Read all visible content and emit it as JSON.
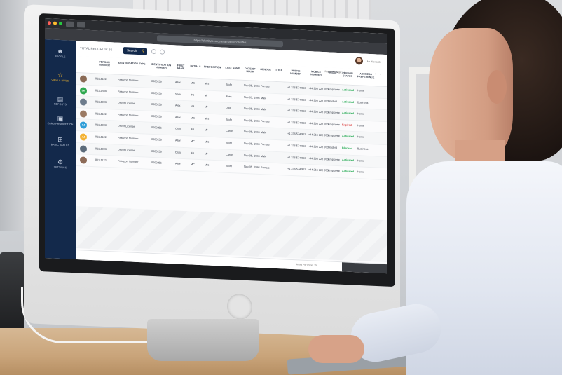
{
  "browser": {
    "url": "https://identityrecords.example/records/list"
  },
  "sidebar": {
    "items": [
      {
        "label": "PEOPLE",
        "icon": "people-icon"
      },
      {
        "label": "VIEW & BUILD",
        "icon": "star-icon"
      },
      {
        "label": "REPORTS",
        "icon": "document-icon"
      },
      {
        "label": "CARD PRODUCTION",
        "icon": "camera-icon"
      },
      {
        "label": "BASIC TABLES",
        "icon": "grid-icon"
      },
      {
        "label": "SETTINGS",
        "icon": "gear-icon"
      }
    ]
  },
  "toolbar": {
    "total_label": "TOTAL RECORDS: 56",
    "search_label": "Search",
    "user_name": "Mr. Kowalski"
  },
  "table": {
    "rows_per_page_label": "Rows Per Page:",
    "columns": [
      "PERSON NUMBER",
      "IDENTIFICATION TYPE",
      "IDENTIFICATION NUMBER",
      "FIRST NAME",
      "INITIALS",
      "PREPOSITION",
      "LAST NAME",
      "DATE OF BIRTH",
      "GENDER",
      "TITLE",
      "PHONE NUMBER",
      "MOBILE NUMBER",
      "GROUP",
      "PERSON STATUS",
      "ADDRESS PREFERENCE"
    ],
    "rows": [
      {
        "avatar": "photo",
        "avatar_color": "#8a6a55",
        "num": "81111122",
        "idtype": "Passport Number",
        "idnum": "0000256",
        "first": "Alton",
        "init": "MC",
        "prep": "Mrs",
        "last": "Jaxfe",
        "dob": "Nov 05, 1986",
        "gender": "Female",
        "title": "",
        "phone": "+1 236 574 963",
        "mobile": "+44 256 222 555",
        "group": "Employee",
        "status": "Activated",
        "status_color": "#1fa84f",
        "addr": "Home"
      },
      {
        "avatar": "SK",
        "avatar_color": "#2ea84f",
        "num": "81111465",
        "idtype": "Passport Number",
        "idnum": "0000256",
        "first": "Sam",
        "init": "TG",
        "prep": "Mr",
        "last": "Allen",
        "dob": "Nov 05, 1986",
        "gender": "Male",
        "title": "",
        "phone": "+1 236 574 963",
        "mobile": "+44 256 222 555",
        "group": "Student",
        "status": "Activated",
        "status_color": "#1fa84f",
        "addr": "Business"
      },
      {
        "avatar": "photo",
        "avatar_color": "#6d7c8c",
        "num": "81111023",
        "idtype": "Driver License",
        "idnum": "0000256",
        "first": "Alex",
        "init": "NB",
        "prep": "Mr",
        "last": "Otto",
        "dob": "Nov 05, 1986",
        "gender": "Male",
        "title": "",
        "phone": "+1 236 574 963",
        "mobile": "+44 256 222 555",
        "group": "Employee",
        "status": "Activated",
        "status_color": "#1fa84f",
        "addr": "Home"
      },
      {
        "avatar": "photo",
        "avatar_color": "#9b7a63",
        "num": "81111122",
        "idtype": "Passport Number",
        "idnum": "0000256",
        "first": "Alton",
        "init": "MC",
        "prep": "Mrs",
        "last": "Jaxfe",
        "dob": "Nov 05, 1986",
        "gender": "Female",
        "title": "",
        "phone": "+1 236 574 963",
        "mobile": "+44 256 222 555",
        "group": "Employee",
        "status": "Expired",
        "status_color": "#d93a3a",
        "addr": "Home"
      },
      {
        "avatar": "CJ",
        "avatar_color": "#2f9ed8",
        "num": "81111020",
        "idtype": "Driver License",
        "idnum": "0000256",
        "first": "Craig",
        "init": "AB",
        "prep": "Mr",
        "last": "Carlos",
        "dob": "Nov 05, 1986",
        "gender": "Male",
        "title": "",
        "phone": "+1 236 574 963",
        "mobile": "+44 256 222 555",
        "group": "Employee",
        "status": "Activated",
        "status_color": "#1fa84f",
        "addr": "Home"
      },
      {
        "avatar": "AJ",
        "avatar_color": "#f3b234",
        "num": "81111122",
        "idtype": "Passport Number",
        "idnum": "0000256",
        "first": "Alton",
        "init": "MC",
        "prep": "Mrs",
        "last": "Jaxfe",
        "dob": "Nov 05, 1986",
        "gender": "Female",
        "title": "",
        "phone": "+1 236 574 963",
        "mobile": "+44 256 222 555",
        "group": "Student",
        "status": "Blocked",
        "status_color": "#1fa84f",
        "addr": "Business"
      },
      {
        "avatar": "photo",
        "avatar_color": "#5c6b7a",
        "num": "81111023",
        "idtype": "Driver License",
        "idnum": "0000256",
        "first": "Craig",
        "init": "AB",
        "prep": "Mr",
        "last": "Carlos",
        "dob": "Nov 05, 1986",
        "gender": "Male",
        "title": "",
        "phone": "+1 236 574 963",
        "mobile": "+44 256 222 555",
        "group": "Employee",
        "status": "Activated",
        "status_color": "#1fa84f",
        "addr": "Home"
      },
      {
        "avatar": "photo",
        "avatar_color": "#8d6b58",
        "num": "81111122",
        "idtype": "Passport Number",
        "idnum": "0000256",
        "first": "Alton",
        "init": "MC",
        "prep": "Mrs",
        "last": "Jaxfe",
        "dob": "Nov 05, 1986",
        "gender": "Female",
        "title": "",
        "phone": "+1 236 574 963",
        "mobile": "+44 256 222 555",
        "group": "Employee",
        "status": "Activated",
        "status_color": "#1fa84f",
        "addr": "Home"
      }
    ]
  },
  "footer": {
    "rows_per_page_label": "Rows Per Page:",
    "rows_per_page_value": "25"
  }
}
